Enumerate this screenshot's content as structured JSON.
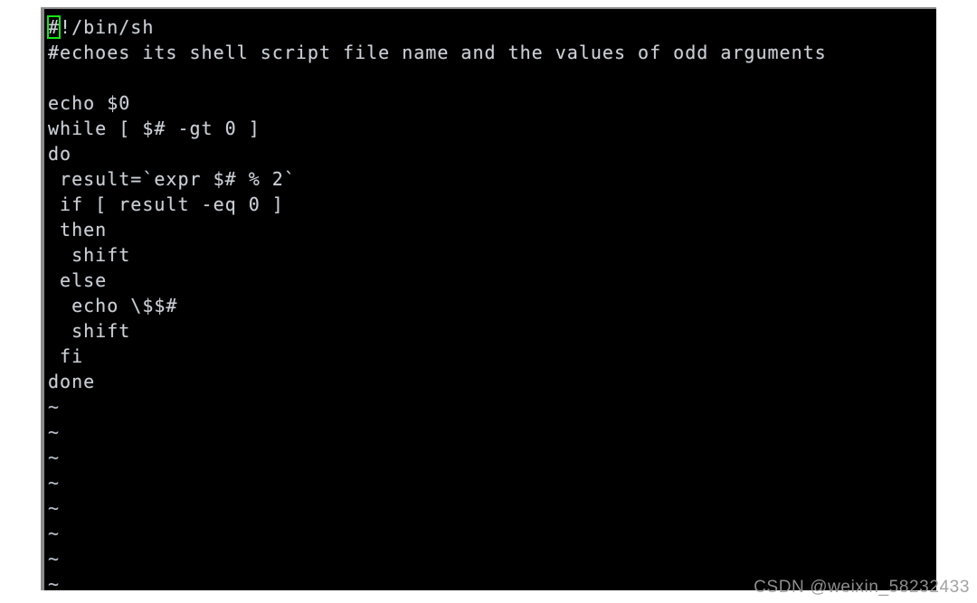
{
  "editor": {
    "type": "vi-text-editor",
    "cursor": {
      "char": "#",
      "color": "#15e515",
      "line": 1,
      "column": 1
    },
    "colors": {
      "background": "#000000",
      "foreground": "#ccd0d4",
      "border": "#8a8a8a",
      "cursor": "#15e515",
      "page_background": "#ffffff"
    },
    "lines": [
      {
        "id": "line-1",
        "rest": "!/bin/sh"
      },
      {
        "id": "line-2",
        "text": "#echoes its shell script file name and the values of odd arguments"
      },
      {
        "id": "line-3",
        "text": ""
      },
      {
        "id": "line-4",
        "text": "echo $0"
      },
      {
        "id": "line-5",
        "text": "while [ $# -gt 0 ]"
      },
      {
        "id": "line-6",
        "text": "do"
      },
      {
        "id": "line-7",
        "text": " result=`expr $# % 2`"
      },
      {
        "id": "line-8",
        "text": " if [ result -eq 0 ]"
      },
      {
        "id": "line-9",
        "text": " then"
      },
      {
        "id": "line-10",
        "text": "  shift"
      },
      {
        "id": "line-11",
        "text": " else"
      },
      {
        "id": "line-12",
        "text": "  echo \\$$#"
      },
      {
        "id": "line-13",
        "text": "  shift"
      },
      {
        "id": "line-14",
        "text": " fi"
      },
      {
        "id": "line-15",
        "text": "done"
      }
    ],
    "empty_markers": [
      {
        "id": "tilde-1",
        "text": "~"
      },
      {
        "id": "tilde-2",
        "text": "~"
      },
      {
        "id": "tilde-3",
        "text": "~"
      },
      {
        "id": "tilde-4",
        "text": "~"
      },
      {
        "id": "tilde-5",
        "text": "~"
      },
      {
        "id": "tilde-6",
        "text": "~"
      },
      {
        "id": "tilde-7",
        "text": "~"
      },
      {
        "id": "tilde-8",
        "text": "~"
      }
    ]
  },
  "watermark": {
    "text": "CSDN @weixin_58232433"
  }
}
